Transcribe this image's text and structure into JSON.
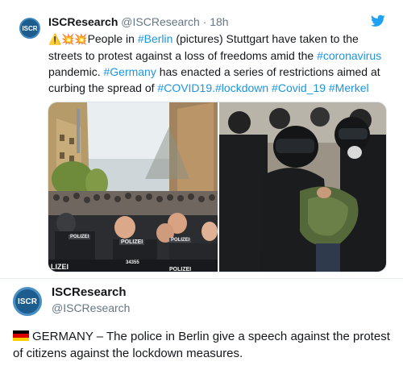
{
  "tweet": {
    "avatar_text": "ISCR",
    "name": "ISCResearch",
    "handle": "@ISCResearch",
    "separator": "·",
    "time": "18h",
    "emojis": "⚠️💥💥",
    "text_1": "People in ",
    "hashtag_berlin": "#Berlin",
    "text_2": " (pictures) Stuttgart have taken to the streets to protest against a loss of freedoms amid the ",
    "hashtag_coronavirus": "#coronavirus",
    "text_3": " pandemic. ",
    "hashtag_germany": "#Germany",
    "text_4": " has enacted a series of restrictions aimed at curbing the spread of ",
    "hashtags_end": "#COVID19.#lockdown #Covid_19 #Merkel",
    "photo_left_badges": [
      "POLIZEI",
      "POLIZEI",
      "POLIZEI"
    ],
    "photo_left_badge_number": "34355",
    "photo_left_corner_text": "LIZEI",
    "photo_left_bottom_text": "POLIZEI"
  },
  "card": {
    "avatar_text": "ISCR",
    "name": "ISCResearch",
    "handle": "@ISCResearch",
    "text": "GERMANY – The police in Berlin give a speech against the protest of citizens against the lockdown measures."
  },
  "colors": {
    "link": "#1b95e0",
    "twitter_blue": "#1da1f2",
    "avatar_blue": "#1c5d8e",
    "secondary_text": "#657786"
  },
  "icons": [
    "twitter-bird-icon",
    "germany-flag-icon",
    "warning-icon",
    "collision-icon"
  ]
}
